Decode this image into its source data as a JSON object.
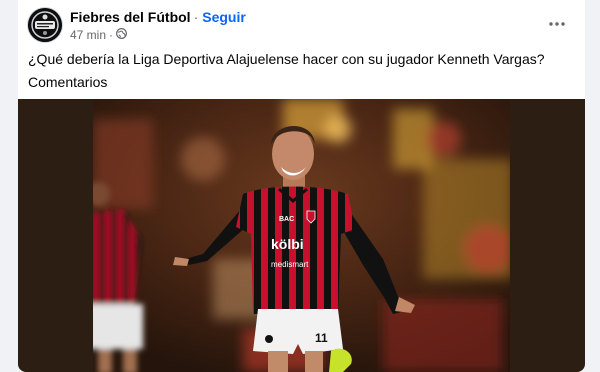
{
  "post": {
    "page_name": "Fiebres del Fútbol",
    "follow_label": "Seguir",
    "separator": "·",
    "time": "47 min",
    "meta_separator": "·",
    "audience_icon": "globe-icon",
    "more_icon": "more-horizontal-icon",
    "text_line1": "¿Qué debería la Liga Deportiva Alajuelense hacer con su jugador Kenneth Vargas?",
    "text_line2": "Comentarios"
  },
  "photo": {
    "jersey_sponsor": "kölbi",
    "jersey_sponsor_2": "medismart",
    "jersey_chest": "BAC",
    "jersey_number": "11"
  },
  "colors": {
    "follow": "#0866ff",
    "secondary_text": "#65676b",
    "jersey_red": "#c8102e",
    "jersey_black": "#111111"
  }
}
